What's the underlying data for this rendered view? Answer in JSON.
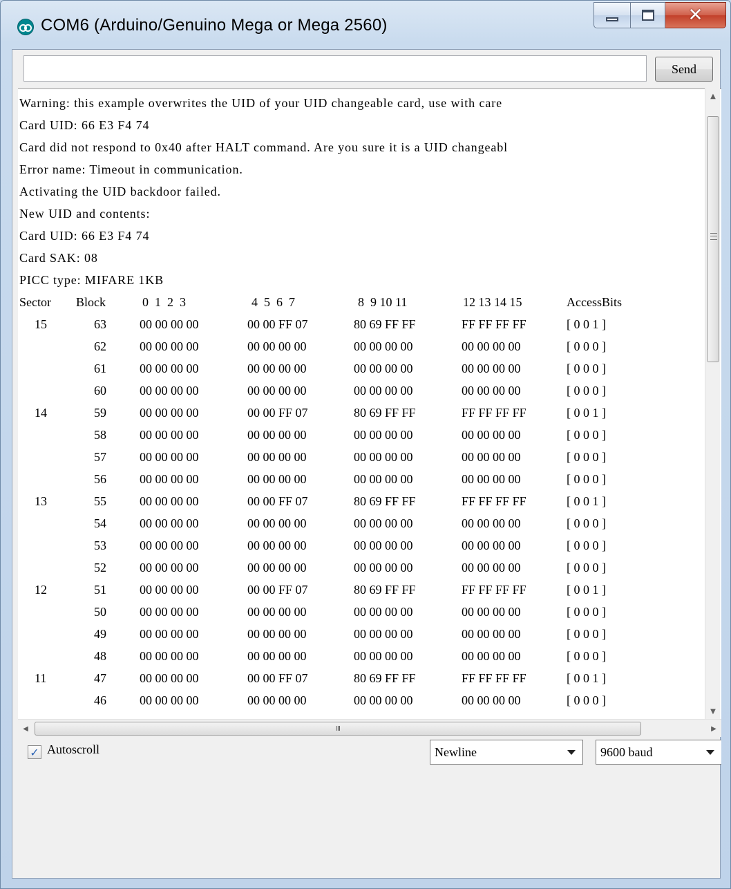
{
  "window": {
    "title": "COM6 (Arduino/Genuino Mega or Mega 2560)"
  },
  "input": {
    "value": ""
  },
  "send_label": "Send",
  "console_text": [
    "Warning: this example overwrites the UID of your UID changeable card, use with care",
    "Card UID: 66 E3 F4 74",
    "Card did not respond to 0x40 after HALT command. Are you sure it is a UID changeabl",
    "Error name: Timeout in communication.",
    "Activating the UID backdoor failed.",
    "New UID and contents:",
    "Card UID: 66 E3 F4 74",
    "Card SAK: 08",
    "PICC type: MIFARE 1KB"
  ],
  "table_header": {
    "sector": "Sector",
    "block": "Block",
    "g1": "0  1  2  3",
    "g2": "4  5  6  7",
    "g3": "8  9 10 11",
    "g4": "12 13 14 15",
    "ab": "AccessBits"
  },
  "table_rows": [
    {
      "sector": "15",
      "block": "63",
      "g1": "00 00 00 00",
      "g2": "00 00 FF 07",
      "g3": "80 69 FF FF",
      "g4": "FF FF FF FF",
      "ab": "[ 0 0 1 ]"
    },
    {
      "sector": "",
      "block": "62",
      "g1": "00 00 00 00",
      "g2": "00 00 00 00",
      "g3": "00 00 00 00",
      "g4": "00 00 00 00",
      "ab": "[ 0 0 0 ]"
    },
    {
      "sector": "",
      "block": "61",
      "g1": "00 00 00 00",
      "g2": "00 00 00 00",
      "g3": "00 00 00 00",
      "g4": "00 00 00 00",
      "ab": "[ 0 0 0 ]"
    },
    {
      "sector": "",
      "block": "60",
      "g1": "00 00 00 00",
      "g2": "00 00 00 00",
      "g3": "00 00 00 00",
      "g4": "00 00 00 00",
      "ab": "[ 0 0 0 ]"
    },
    {
      "sector": "14",
      "block": "59",
      "g1": "00 00 00 00",
      "g2": "00 00 FF 07",
      "g3": "80 69 FF FF",
      "g4": "FF FF FF FF",
      "ab": "[ 0 0 1 ]"
    },
    {
      "sector": "",
      "block": "58",
      "g1": "00 00 00 00",
      "g2": "00 00 00 00",
      "g3": "00 00 00 00",
      "g4": "00 00 00 00",
      "ab": "[ 0 0 0 ]"
    },
    {
      "sector": "",
      "block": "57",
      "g1": "00 00 00 00",
      "g2": "00 00 00 00",
      "g3": "00 00 00 00",
      "g4": "00 00 00 00",
      "ab": "[ 0 0 0 ]"
    },
    {
      "sector": "",
      "block": "56",
      "g1": "00 00 00 00",
      "g2": "00 00 00 00",
      "g3": "00 00 00 00",
      "g4": "00 00 00 00",
      "ab": "[ 0 0 0 ]"
    },
    {
      "sector": "13",
      "block": "55",
      "g1": "00 00 00 00",
      "g2": "00 00 FF 07",
      "g3": "80 69 FF FF",
      "g4": "FF FF FF FF",
      "ab": "[ 0 0 1 ]"
    },
    {
      "sector": "",
      "block": "54",
      "g1": "00 00 00 00",
      "g2": "00 00 00 00",
      "g3": "00 00 00 00",
      "g4": "00 00 00 00",
      "ab": "[ 0 0 0 ]"
    },
    {
      "sector": "",
      "block": "53",
      "g1": "00 00 00 00",
      "g2": "00 00 00 00",
      "g3": "00 00 00 00",
      "g4": "00 00 00 00",
      "ab": "[ 0 0 0 ]"
    },
    {
      "sector": "",
      "block": "52",
      "g1": "00 00 00 00",
      "g2": "00 00 00 00",
      "g3": "00 00 00 00",
      "g4": "00 00 00 00",
      "ab": "[ 0 0 0 ]"
    },
    {
      "sector": "12",
      "block": "51",
      "g1": "00 00 00 00",
      "g2": "00 00 FF 07",
      "g3": "80 69 FF FF",
      "g4": "FF FF FF FF",
      "ab": "[ 0 0 1 ]"
    },
    {
      "sector": "",
      "block": "50",
      "g1": "00 00 00 00",
      "g2": "00 00 00 00",
      "g3": "00 00 00 00",
      "g4": "00 00 00 00",
      "ab": "[ 0 0 0 ]"
    },
    {
      "sector": "",
      "block": "49",
      "g1": "00 00 00 00",
      "g2": "00 00 00 00",
      "g3": "00 00 00 00",
      "g4": "00 00 00 00",
      "ab": "[ 0 0 0 ]"
    },
    {
      "sector": "",
      "block": "48",
      "g1": "00 00 00 00",
      "g2": "00 00 00 00",
      "g3": "00 00 00 00",
      "g4": "00 00 00 00",
      "ab": "[ 0 0 0 ]"
    },
    {
      "sector": "11",
      "block": "47",
      "g1": "00 00 00 00",
      "g2": "00 00 FF 07",
      "g3": "80 69 FF FF",
      "g4": "FF FF FF FF",
      "ab": "[ 0 0 1 ]"
    },
    {
      "sector": "",
      "block": "46",
      "g1": "00 00 00 00",
      "g2": "00 00 00 00",
      "g3": "00 00 00 00",
      "g4": "00 00 00 00",
      "ab": "[ 0 0 0 ]"
    }
  ],
  "footer": {
    "autoscroll_label": "Autoscroll",
    "autoscroll_checked": true,
    "line_ending": "Newline",
    "baud": "9600 baud"
  },
  "scrollbar": {
    "h_grip": "III"
  }
}
